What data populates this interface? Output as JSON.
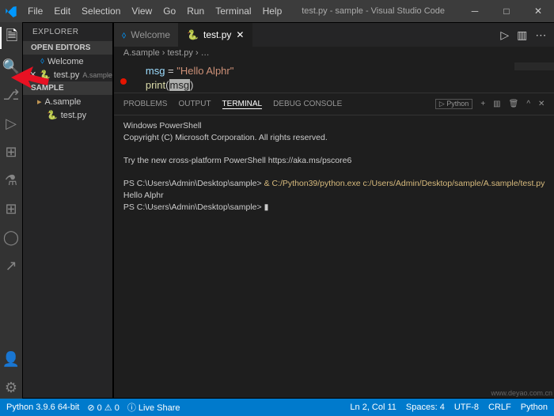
{
  "titlebar": {
    "menus": [
      "File",
      "Edit",
      "Selection",
      "View",
      "Go",
      "Run",
      "Terminal",
      "Help"
    ],
    "title": "test.py - sample - Visual Studio Code"
  },
  "sidebar": {
    "header": "EXPLORER",
    "openEditors": "OPEN EDITORS",
    "openItems": [
      {
        "icon": "☆",
        "name": "Welcome"
      },
      {
        "icon": "✕",
        "name": "test.py",
        "badge": "A.sample"
      }
    ],
    "folder": "SAMPLE",
    "files": [
      {
        "name": "A.sample"
      },
      {
        "name": "test.py"
      }
    ]
  },
  "tabs": [
    {
      "icon": "☆",
      "label": "Welcome",
      "active": false
    },
    {
      "icon": "🐍",
      "label": "test.py",
      "active": true
    }
  ],
  "breadcrumb": "A.sample  ›  test.py  ›  …",
  "code": {
    "line1_var": "msg",
    "line1_assign": " = ",
    "line1_str": "\"Hello Alphr\"",
    "line2_fn": "print",
    "line2_paren": "(",
    "line2_var": "msg",
    "line2_close": ")"
  },
  "panel": {
    "tabs": [
      "PROBLEMS",
      "OUTPUT",
      "TERMINAL",
      "DEBUG CONSOLE"
    ],
    "shellLabel": "Python",
    "lines": {
      "l1": "Windows PowerShell",
      "l2": "Copyright (C) Microsoft Corporation. All rights reserved.",
      "l3": "",
      "l4": "Try the new cross-platform PowerShell https://aka.ms/pscore6",
      "l5": "",
      "l6a": "PS C:\\Users\\Admin\\Desktop\\sample> ",
      "l6b": "& C:/Python39/python.exe c:/Users/Admin/Desktop/sample/A.sample/test.py",
      "l7": "Hello Alphr",
      "l8": "PS C:\\Users\\Admin\\Desktop\\sample> "
    }
  },
  "status": {
    "python": "Python 3.9.6 64-bit",
    "errors": "⊘ 0 ⚠ 0",
    "liveshare": "ⓘ Live Share",
    "pos": "Ln 2, Col 11",
    "spaces": "Spaces: 4",
    "enc": "UTF-8",
    "eol": "CRLF",
    "lang": "Python"
  },
  "watermark": "www.deyao.com.cn"
}
